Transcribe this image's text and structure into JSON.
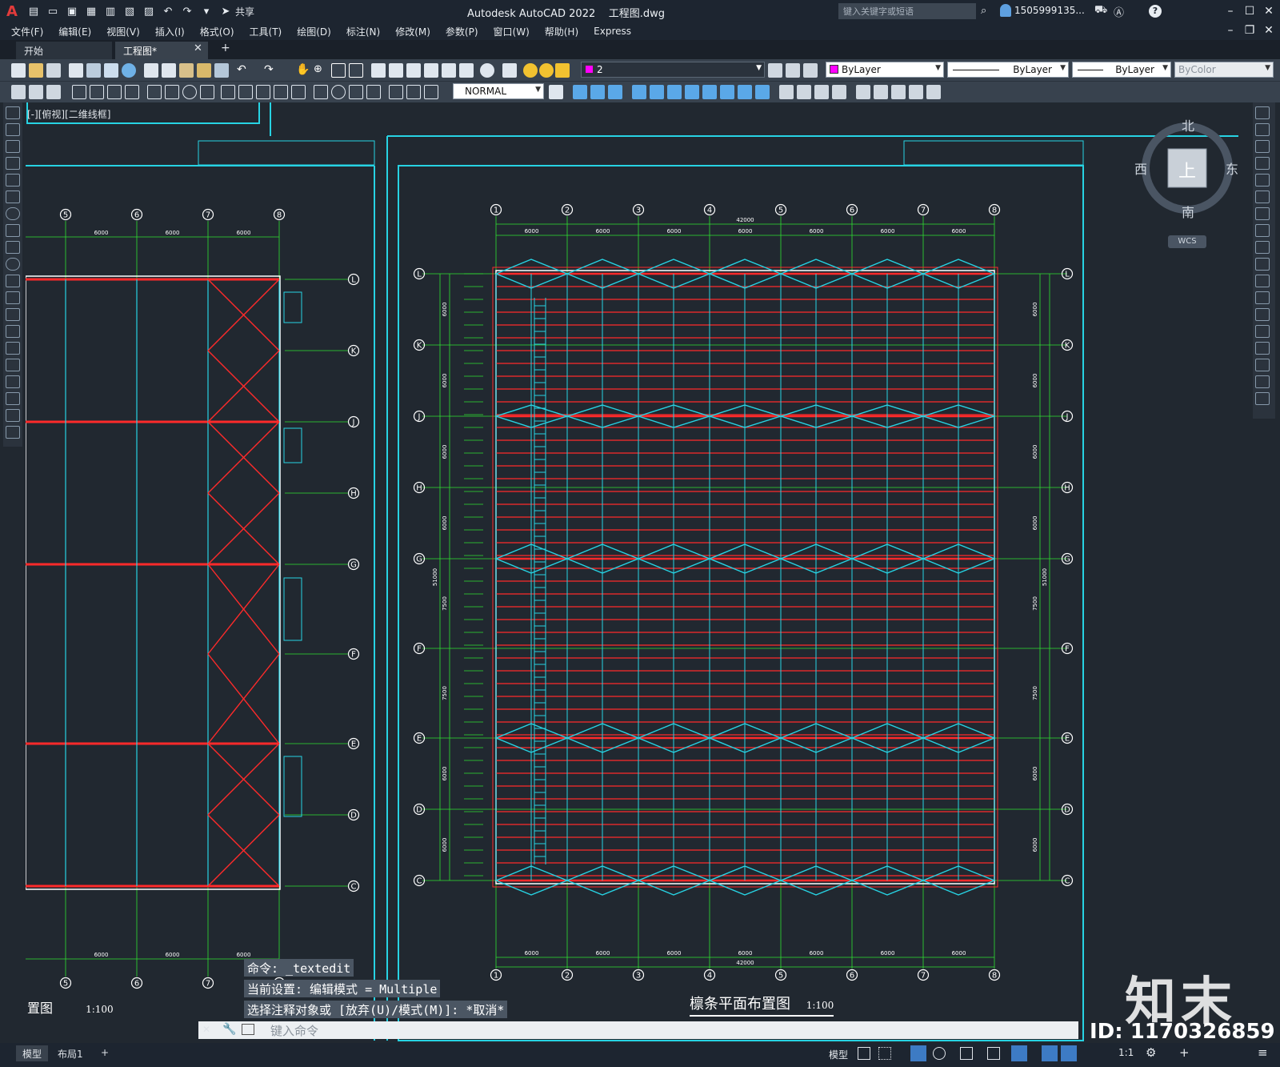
{
  "app": {
    "title": "Autodesk AutoCAD 2022",
    "file_name": "工程图.dwg",
    "share_label": "共享",
    "help_search_placeholder": "键入关键字或短语",
    "user_name": "1505999135..."
  },
  "menu": {
    "items": [
      "文件(F)",
      "编辑(E)",
      "视图(V)",
      "插入(I)",
      "格式(O)",
      "工具(T)",
      "绘图(D)",
      "标注(N)",
      "修改(M)",
      "参数(P)",
      "窗口(W)",
      "帮助(H)",
      "Express"
    ]
  },
  "tabs": {
    "start": "开始",
    "drawing": "工程图*",
    "close_glyph": "✕",
    "add_glyph": "+"
  },
  "properties": {
    "layer_value": "2",
    "color_value": "ByLayer",
    "linetype_value": "ByLayer",
    "lineweight_value": "ByLayer",
    "plotstyle_value": "ByColor",
    "dimstyle_value": "NORMAL"
  },
  "viewport": {
    "label": "[-][俯视][二维线框]"
  },
  "viewcube": {
    "north": "北",
    "south": "南",
    "east": "东",
    "west": "西",
    "top": "上",
    "wcs": "WCS"
  },
  "drawing": {
    "left_plan": {
      "title_partial": "置图",
      "scale": "1:100",
      "col_labels": [
        "5",
        "6",
        "7",
        "8"
      ],
      "row_labels": [
        "L",
        "K",
        "J",
        "H",
        "G",
        "F",
        "E",
        "D",
        "C"
      ],
      "span_dims": [
        "6000",
        "6000",
        "6000"
      ]
    },
    "right_plan": {
      "title": "檩条平面布置图",
      "scale": "1:100",
      "col_labels": [
        "1",
        "2",
        "3",
        "4",
        "5",
        "6",
        "7",
        "8"
      ],
      "row_labels": [
        "L",
        "K",
        "J",
        "H",
        "G",
        "F",
        "E",
        "D",
        "C"
      ],
      "span_dims": [
        "6000",
        "6000",
        "6000",
        "6000",
        "6000",
        "6000",
        "6000"
      ],
      "total_dim": "42000",
      "side_dims": [
        "6000",
        "6000",
        "6000",
        "6000",
        "7500",
        "7500",
        "6000",
        "6000"
      ],
      "total_side_dim": "51000"
    }
  },
  "command": {
    "history": [
      "命令: _textedit",
      "当前设置: 编辑模式 = Multiple",
      "选择注释对象或 [放弃(U)/模式(M)]: *取消*"
    ],
    "input_placeholder": "键入命令",
    "close_glyph": "✕"
  },
  "layout_tabs": [
    "模型",
    "布局1"
  ],
  "layout_add": "+",
  "status": {
    "model": "模型",
    "scale": "1:1"
  },
  "watermark": {
    "brand": "知末",
    "id": "ID: 1170326859"
  },
  "colors": {
    "accent_cyan": "#27d3e3",
    "beam_red": "#ff2a2a",
    "grid_green": "#30e030",
    "background": "#212830"
  }
}
